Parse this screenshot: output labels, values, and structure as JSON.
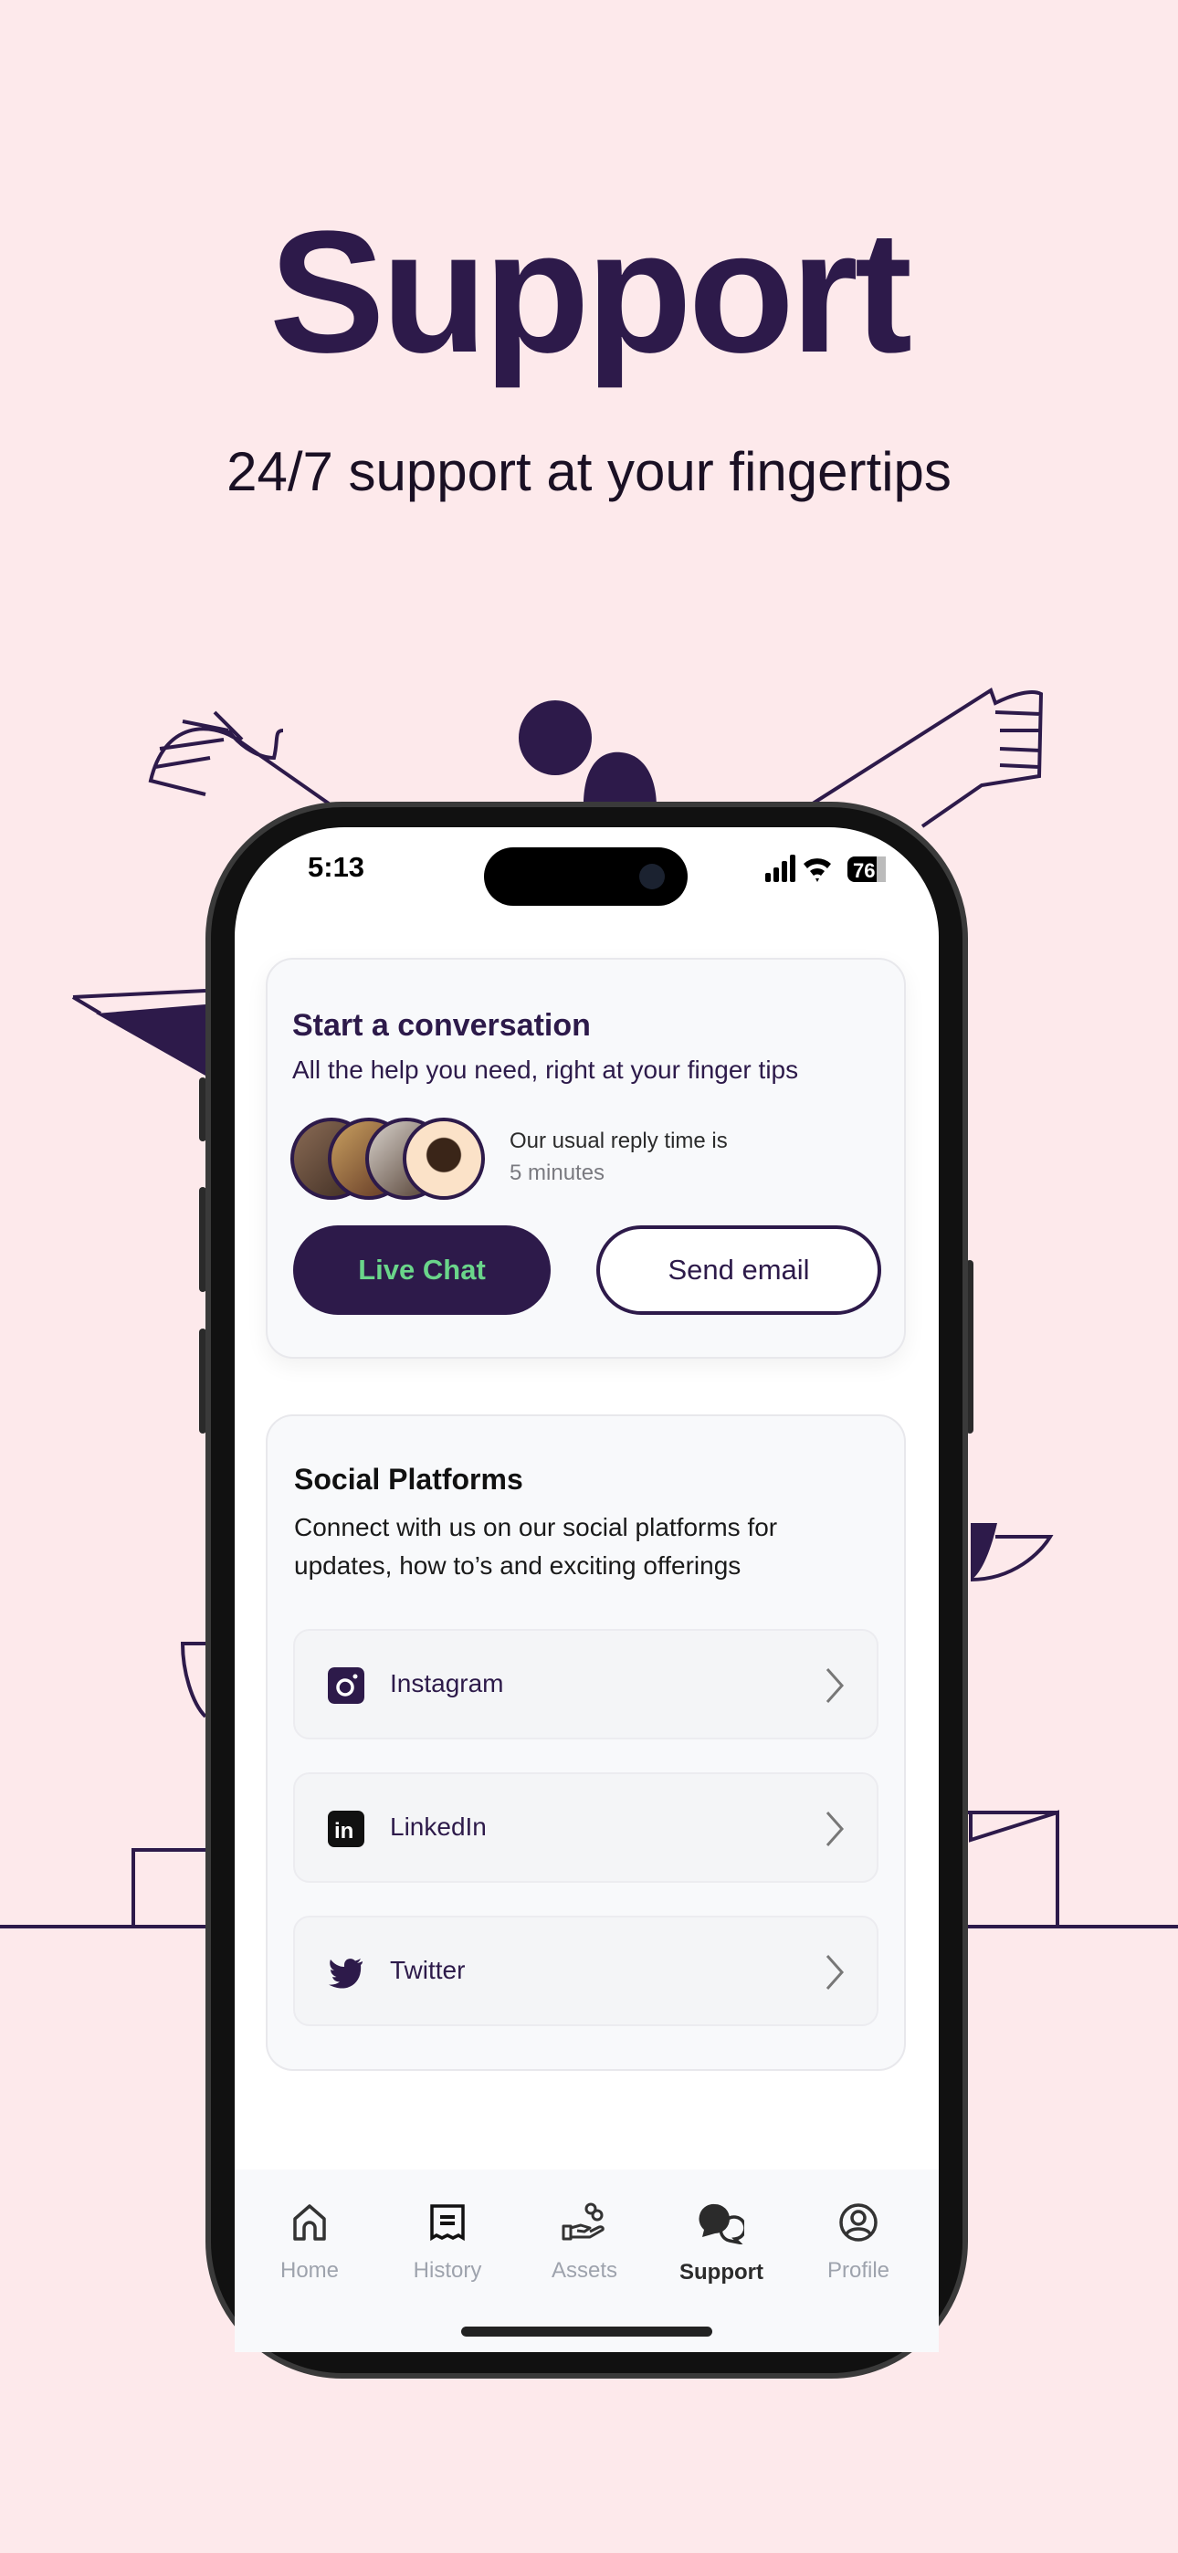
{
  "hero": {
    "title": "Support",
    "subtitle": "24/7 support at your fingertips"
  },
  "status_bar": {
    "time": "5:13",
    "battery": "76"
  },
  "conversation_card": {
    "title": "Start a conversation",
    "subtitle": "All the help you need, right at your finger tips",
    "reply_label": "Our usual reply time is",
    "reply_time": "5 minutes",
    "live_chat_label": "Live Chat",
    "send_email_label": "Send email"
  },
  "social_card": {
    "title": "Social Platforms",
    "description": "Connect with us on our social platforms for updates, how to’s and exciting offerings",
    "items": [
      {
        "label": "Instagram",
        "icon": "instagram-icon"
      },
      {
        "label": "LinkedIn",
        "icon": "linkedin-icon"
      },
      {
        "label": "Twitter",
        "icon": "twitter-icon"
      }
    ]
  },
  "tab_bar": {
    "items": [
      {
        "label": "Home",
        "icon": "home-icon"
      },
      {
        "label": "History",
        "icon": "receipt-icon"
      },
      {
        "label": "Assets",
        "icon": "hand-coins-icon"
      },
      {
        "label": "Support",
        "icon": "chat-bubbles-icon",
        "active": true
      },
      {
        "label": "Profile",
        "icon": "user-circle-icon"
      }
    ]
  },
  "colors": {
    "brand": "#2d1a4a",
    "accent_green": "#6ad58a",
    "background": "#fde9eb"
  }
}
